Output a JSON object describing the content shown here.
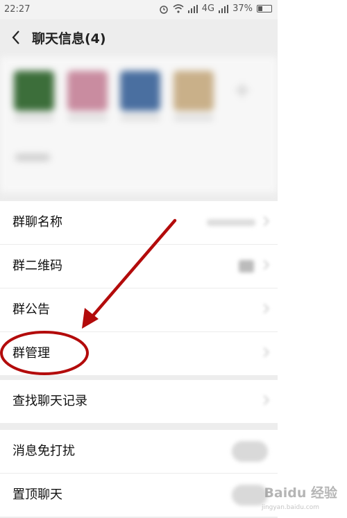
{
  "status_bar": {
    "time": "22:27",
    "network": "4G",
    "battery": "37%"
  },
  "header": {
    "title": "聊天信息(4)"
  },
  "members": {
    "avatars": [
      {
        "color": "#3c6e3a"
      },
      {
        "color": "#c98ca0"
      },
      {
        "color": "#4a6fa0"
      },
      {
        "color": "#c9b089"
      }
    ]
  },
  "menu_group_1": [
    {
      "label": "群聊名称"
    },
    {
      "label": "群二维码"
    },
    {
      "label": "群公告"
    },
    {
      "label": "群管理"
    }
  ],
  "menu_group_2": [
    {
      "label": "查找聊天记录"
    }
  ],
  "menu_group_3": [
    {
      "label": "消息免打扰"
    },
    {
      "label": "置顶聊天"
    }
  ],
  "annotation_color": "#b30b0b",
  "watermark": {
    "text": "Baidu 经验",
    "sub": "jingyan.baidu.com"
  }
}
